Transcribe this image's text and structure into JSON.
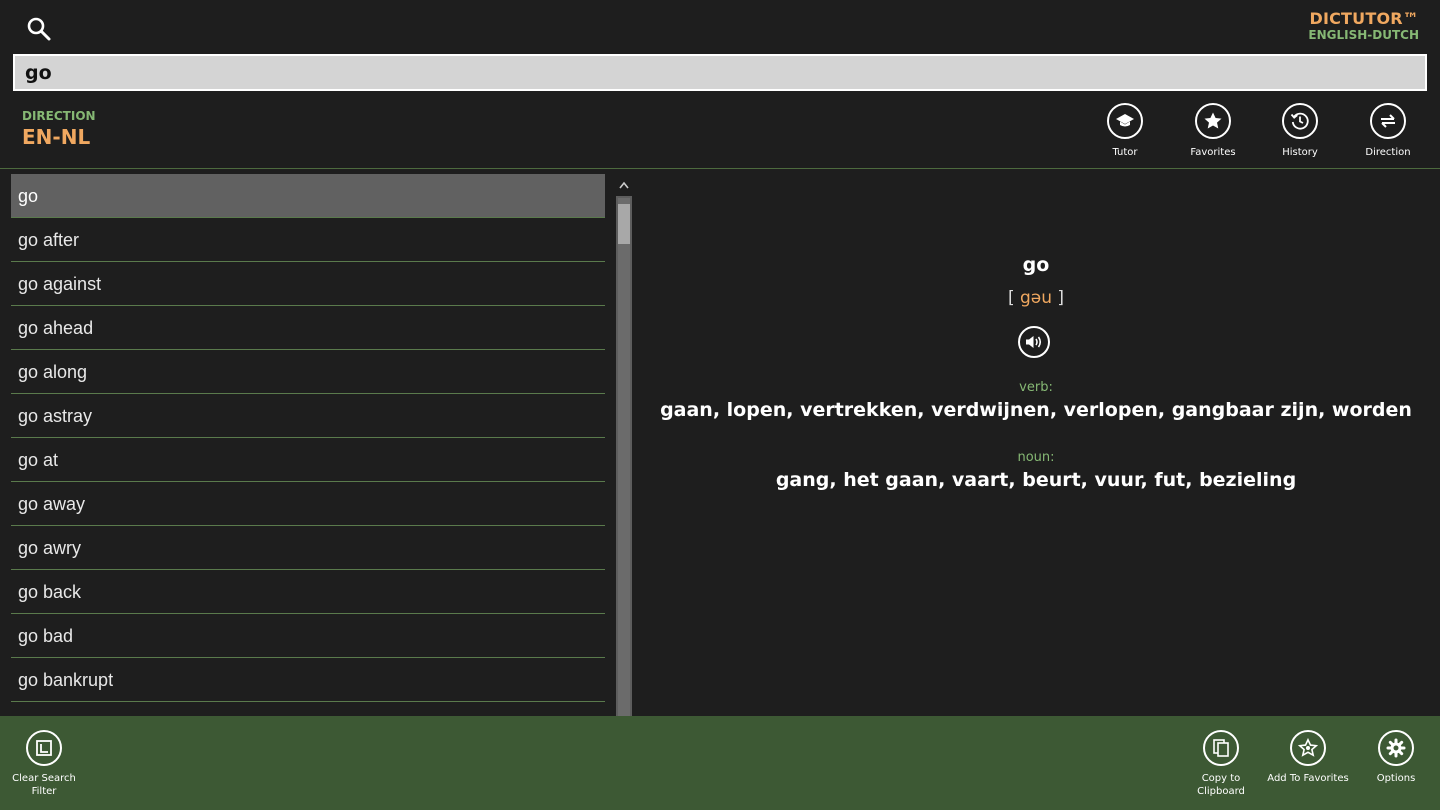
{
  "app": {
    "brand": "DICTUTOR™",
    "subtitle": "ENGLISH-DUTCH"
  },
  "search": {
    "value": "go",
    "icon": "search-icon"
  },
  "direction": {
    "label": "DIRECTION",
    "value": "EN-NL"
  },
  "toolbar": {
    "tutor": "Tutor",
    "favorites": "Favorites",
    "history": "History",
    "direction": "Direction"
  },
  "list": {
    "items": [
      "go",
      "go after",
      "go against",
      "go ahead",
      "go along",
      "go astray",
      "go at",
      "go away",
      "go awry",
      "go back",
      "go bad",
      "go bankrupt"
    ],
    "selected_index": 0
  },
  "entry": {
    "word": "go",
    "bracket_open": "[",
    "phonetic": "gəu",
    "bracket_close": "]",
    "senses": [
      {
        "pos": "verb:",
        "translation": "gaan, lopen, vertrekken, verdwijnen, verlopen, gangbaar zijn, worden"
      },
      {
        "pos": "noun:",
        "translation": "gang, het gaan, vaart, beurt, vuur, fut, bezieling"
      }
    ]
  },
  "bottombar": {
    "clear_line1": "Clear Search",
    "clear_line2": "Filter",
    "copy_line1": "Copy to",
    "copy_line2": "Clipboard",
    "add_favorites": "Add To Favorites",
    "options": "Options"
  },
  "colors": {
    "accent_orange": "#f0a860",
    "accent_green": "#86b874",
    "bar_green": "#3d5934",
    "background": "#1e1e1e"
  }
}
